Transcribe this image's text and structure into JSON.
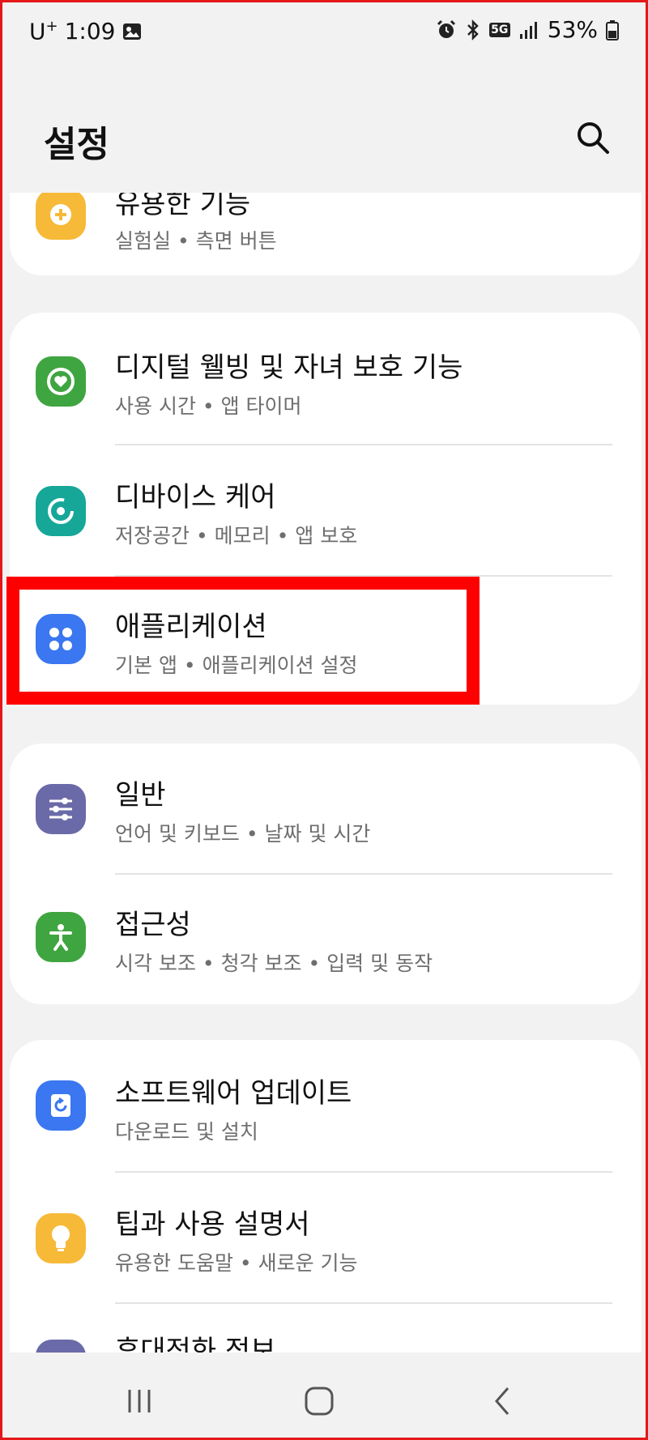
{
  "status": {
    "carrier": "U",
    "carrier_sup": "+",
    "time": "1:09",
    "network": "5G",
    "battery": "53%"
  },
  "header": {
    "title": "설정"
  },
  "cards": [
    {
      "items": [
        {
          "title": "유용한 기능",
          "subtitle": "실험실 • 측면 버튼",
          "icon": "plus-gear-icon",
          "color": "#f6b938"
        }
      ]
    },
    {
      "items": [
        {
          "title": "디지털 웰빙 및 자녀 보호 기능",
          "subtitle": "사용 시간 • 앱 타이머",
          "icon": "wellbeing-heart-icon",
          "color": "#3fa540"
        },
        {
          "title": "디바이스 케어",
          "subtitle": "저장공간 • 메모리 • 앱 보호",
          "icon": "device-care-icon",
          "color": "#17a799"
        },
        {
          "title": "애플리케이션",
          "subtitle": "기본 앱 • 애플리케이션 설정",
          "icon": "apps-grid-icon",
          "color": "#3a77f0"
        }
      ]
    },
    {
      "items": [
        {
          "title": "일반",
          "subtitle": "언어 및 키보드 • 날짜 및 시간",
          "icon": "sliders-icon",
          "color": "#6b6aa8"
        },
        {
          "title": "접근성",
          "subtitle": "시각 보조 • 청각 보조 • 입력 및 동작",
          "icon": "accessibility-person-icon",
          "color": "#3fa540"
        }
      ]
    },
    {
      "items": [
        {
          "title": "소프트웨어 업데이트",
          "subtitle": "다운로드 및 설치",
          "icon": "software-update-icon",
          "color": "#3a77f0"
        },
        {
          "title": "팁과 사용 설명서",
          "subtitle": "유용한 도움말 • 새로운 기능",
          "icon": "lightbulb-icon",
          "color": "#f6b938"
        },
        {
          "title": "휴대전화 정보",
          "subtitle": "",
          "icon": "phone-info-icon",
          "color": "#6b6aa8"
        }
      ]
    }
  ]
}
